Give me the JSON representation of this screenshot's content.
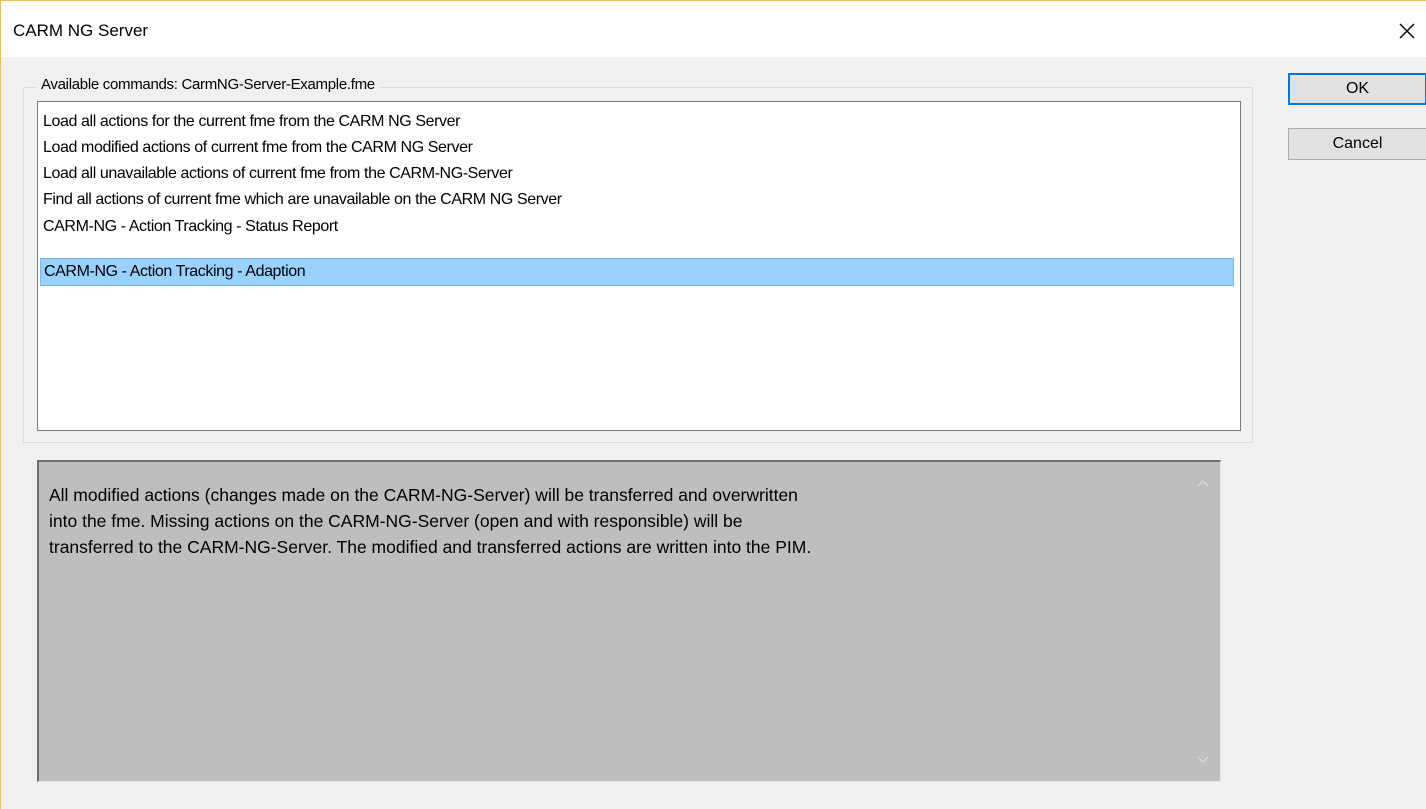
{
  "window": {
    "title": "CARM NG Server"
  },
  "commands": {
    "legend": "Available commands: CarmNG-Server-Example.fme",
    "items": [
      {
        "label": "Load all actions for the current fme from the CARM NG Server"
      },
      {
        "label": "Load modified actions of current fme from the CARM NG Server"
      },
      {
        "label": "Load all unavailable actions of current fme from the CARM-NG-Server"
      },
      {
        "label": "Find all actions of current fme which are unavailable on the CARM NG Server"
      },
      {
        "label": "CARM-NG - Action Tracking - Status Report"
      },
      {
        "label": "CARM-NG - Action Tracking - Adaption"
      }
    ],
    "selected_label": "CARM-NG - Action Tracking - Adaption"
  },
  "description": {
    "text": "All modified actions (changes made on the CARM-NG-Server) will be transferred and overwritten\ninto the fme. Missing actions on the CARM-NG-Server (open and with responsible) will be\ntransferred to the CARM-NG-Server. The modified and transferred actions are written into the PIM."
  },
  "buttons": {
    "ok": "OK",
    "cancel": "Cancel"
  },
  "icons": {
    "close": "close-icon",
    "scroll_up": "chevron-up-icon",
    "scroll_down": "chevron-down-icon"
  },
  "colors": {
    "selection": "#99d1ff",
    "description_background": "#bebebe",
    "default_button_border": "#0078d7"
  }
}
